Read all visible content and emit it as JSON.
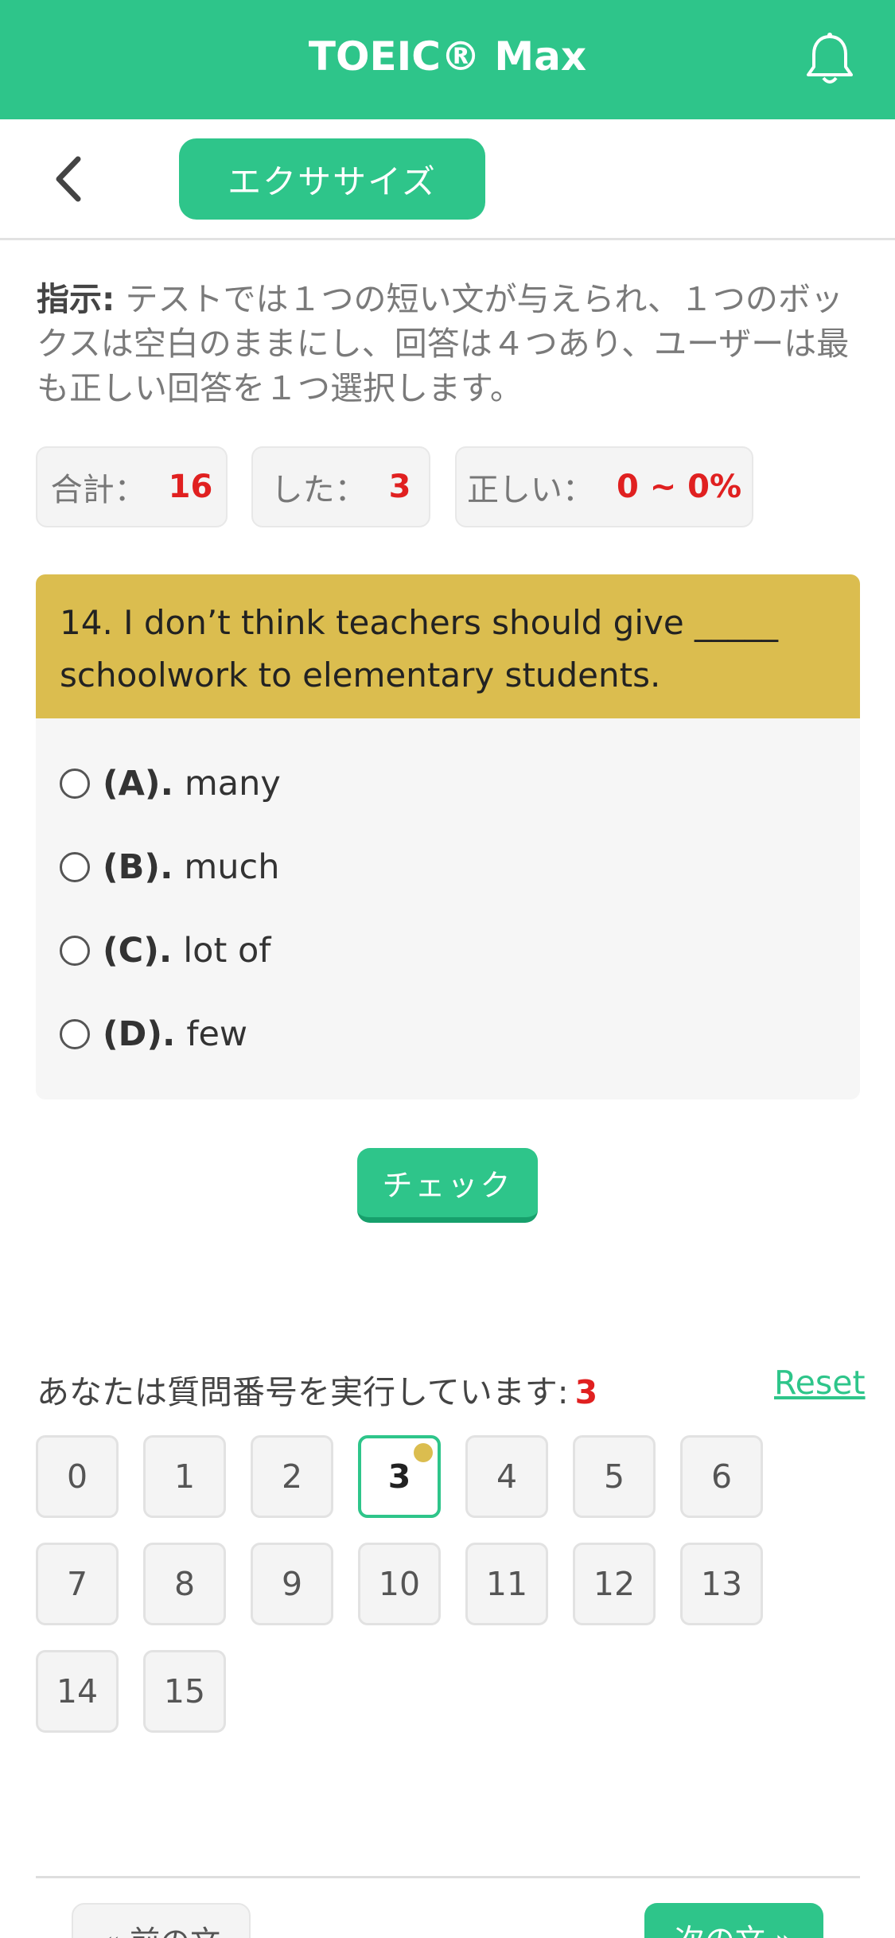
{
  "header": {
    "title": "TOEIC® Max",
    "notification_icon": "bell-icon"
  },
  "nav": {
    "back_icon": "chevron-left-icon",
    "tab_label": "エクササイズ"
  },
  "instruction": {
    "label": "指示:",
    "text": " テストでは１つの短い文が与えられ、１つのボックスは空白のままにし、回答は４つあり、ユーザーは最も正しい回答を１つ選択します。"
  },
  "stats": {
    "total_label": "合計：",
    "total_value": "16",
    "done_label": "した：",
    "done_value": "3",
    "correct_label": "正しい：",
    "correct_value": "0 ~ 0%"
  },
  "question": {
    "text": "14. I don’t think teachers should give _____ schoolwork to elementary students.",
    "options": [
      {
        "label": "(A).",
        "text": "many"
      },
      {
        "label": "(B).",
        "text": "much"
      },
      {
        "label": "(C).",
        "text": "lot of"
      },
      {
        "label": "(D).",
        "text": "few"
      }
    ]
  },
  "check_button": "チェック",
  "progress": {
    "text": "あなたは質問番号を実行しています:",
    "current": "3",
    "reset_label": "Reset"
  },
  "question_numbers": [
    "0",
    "1",
    "2",
    "3",
    "4",
    "5",
    "6",
    "7",
    "8",
    "9",
    "10",
    "11",
    "12",
    "13",
    "14",
    "15"
  ],
  "active_question": "3",
  "footer": {
    "prev_label": "« 前の文",
    "next_label": "次の文 »"
  },
  "colors": {
    "brand_green": "#2ec58a",
    "question_header": "#dbbd4f",
    "highlight_red": "#e02020"
  }
}
